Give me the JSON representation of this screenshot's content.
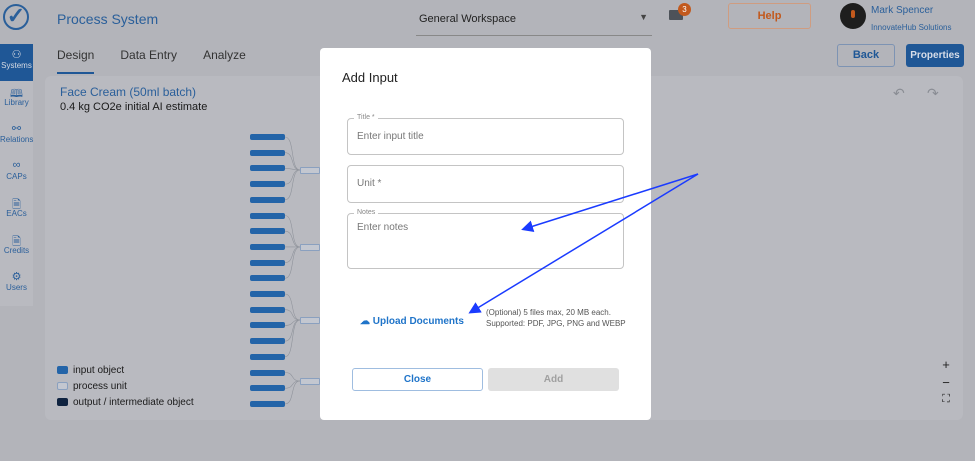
{
  "app": {
    "title": "Process System",
    "logo": "checkmark-logo"
  },
  "sidebar": {
    "items": [
      {
        "label": "Systems",
        "icon": "systems-icon",
        "active": true
      },
      {
        "label": "Library",
        "icon": "book-icon"
      },
      {
        "label": "Relations",
        "icon": "relations-icon"
      },
      {
        "label": "CAPs",
        "icon": "caps-icon"
      },
      {
        "label": "EACs",
        "icon": "document-icon"
      },
      {
        "label": "Credits",
        "icon": "document-icon"
      },
      {
        "label": "Users",
        "icon": "users-icon"
      }
    ]
  },
  "tabs": [
    {
      "label": "Design",
      "active": true
    },
    {
      "label": "Data Entry"
    },
    {
      "label": "Analyze"
    }
  ],
  "header": {
    "workspace": "General Workspace",
    "mail_count": "3",
    "help": "Help",
    "user_name": "Mark Spencer",
    "user_org": "InnovateHub Solutions",
    "back": "Back",
    "properties": "Properties"
  },
  "system": {
    "title": "Face Cream (50ml batch)",
    "subtitle": "0.4 kg CO2e initial AI estimate"
  },
  "legend": [
    {
      "label": "input object",
      "color": "#2364a8"
    },
    {
      "label": "process unit",
      "color": "#c3c7d0"
    },
    {
      "label": "output / intermediate object",
      "color": "#0f2340"
    }
  ],
  "zoom_controls": {
    "plus": "+",
    "minus": "−",
    "fit": "⛶"
  },
  "modal": {
    "title": "Add Input",
    "title_label": "Title *",
    "title_placeholder": "Enter input title",
    "unit_placeholder": "Unit *",
    "notes_label": "Notes",
    "notes_placeholder": "Enter notes",
    "upload": "Upload Documents",
    "upload_hint": "(Optional) 5 files max, 20 MB each. Supported: PDF, JPG, PNG and WEBP",
    "close": "Close",
    "add": "Add"
  },
  "colors": {
    "primary": "#1f5796",
    "accent": "#c2591d",
    "arrow": "#1a3bff"
  }
}
